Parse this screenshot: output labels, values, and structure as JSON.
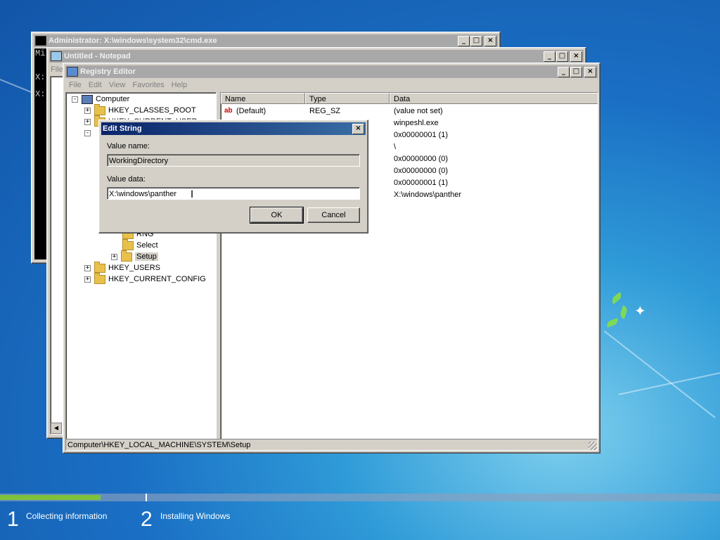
{
  "cmd_window": {
    "title": "Administrator: X:\\windows\\system32\\cmd.exe",
    "lines": [
      "Mi",
      "X:",
      "X:"
    ]
  },
  "notepad_window": {
    "title": "Untitled - Notepad",
    "menu": [
      "File"
    ]
  },
  "regedit": {
    "title": "Registry Editor",
    "menu": [
      "File",
      "Edit",
      "View",
      "Favorites",
      "Help"
    ],
    "tree": {
      "root": "Computer",
      "hkcr": "HKEY_CLASSES_ROOT",
      "hkcu_partial": "HKEY_CURRENT_USER",
      "rng": "RNG",
      "select": "Select",
      "setup": "Setup",
      "hku": "HKEY_USERS",
      "hkcc": "HKEY_CURRENT_CONFIG"
    },
    "columns": {
      "name": "Name",
      "type": "Type",
      "data": "Data"
    },
    "values": [
      {
        "name": "(Default)",
        "type": "REG_SZ",
        "data": "(value not set)"
      },
      {
        "name": "",
        "type": "",
        "data": "winpeshl.exe"
      },
      {
        "name": "",
        "type": "",
        "data": "0x00000001 (1)"
      },
      {
        "name": "",
        "type": "",
        "data": "\\"
      },
      {
        "name": "",
        "type": "",
        "data": "0x00000000 (0)"
      },
      {
        "name": "",
        "type": "",
        "data": "0x00000000 (0)"
      },
      {
        "name": "",
        "type": "",
        "data": "0x00000001 (1)"
      },
      {
        "name": "",
        "type": "",
        "data": "X:\\windows\\panther"
      }
    ],
    "status": "Computer\\HKEY_LOCAL_MACHINE\\SYSTEM\\Setup"
  },
  "edit_dialog": {
    "title": "Edit String",
    "value_name_label": "Value name:",
    "value_name": "WorkingDirectory",
    "value_data_label": "Value data:",
    "value_data": "X:\\windows\\panther",
    "ok": "OK",
    "cancel": "Cancel"
  },
  "window_buttons": {
    "minimize": "_",
    "maximize": "□",
    "close": "×"
  },
  "setup": {
    "steps": [
      {
        "number": "1",
        "label": "Collecting information"
      },
      {
        "number": "2",
        "label": "Installing Windows"
      }
    ],
    "progress_fraction": 0.14
  }
}
